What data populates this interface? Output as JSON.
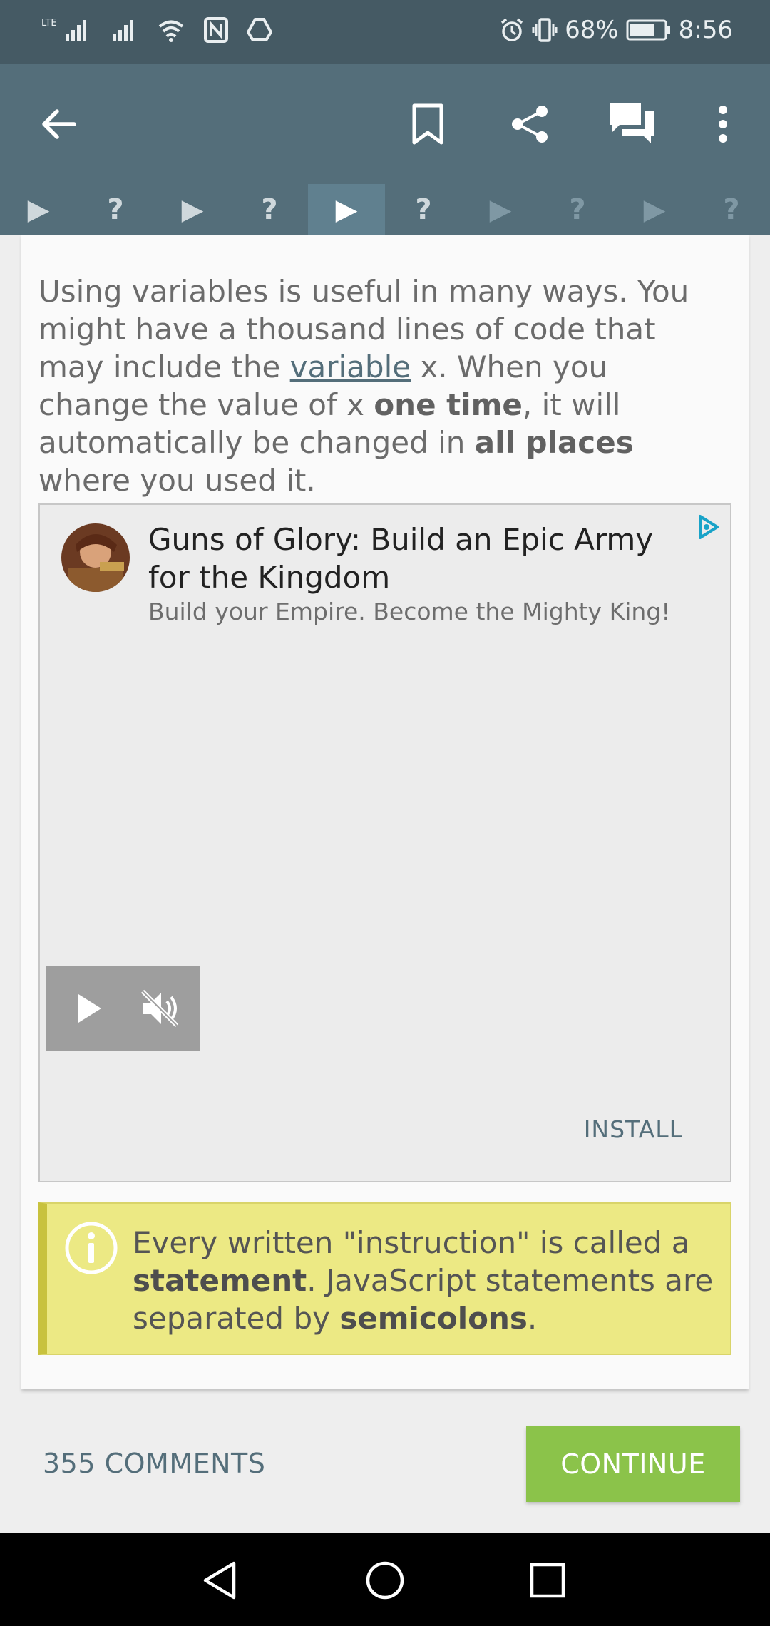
{
  "status_bar": {
    "network_label": "LTE",
    "battery_percent": "68%",
    "time": "8:56"
  },
  "app_bar": {
    "back_icon": "arrow-left-icon",
    "actions": [
      "bookmark-icon",
      "share-icon",
      "comments-icon",
      "more-vert-icon"
    ]
  },
  "lesson_steps": [
    {
      "type": "play",
      "glyph": "▶"
    },
    {
      "type": "quiz",
      "glyph": "?"
    },
    {
      "type": "play",
      "glyph": "▶"
    },
    {
      "type": "quiz",
      "glyph": "?"
    },
    {
      "type": "play",
      "glyph": "▶",
      "active": true
    },
    {
      "type": "quiz",
      "glyph": "?"
    },
    {
      "type": "play",
      "glyph": "▶",
      "locked": true
    },
    {
      "type": "quiz",
      "glyph": "?",
      "locked": true
    },
    {
      "type": "play",
      "glyph": "▶",
      "locked": true
    },
    {
      "type": "quiz",
      "glyph": "?",
      "locked": true
    }
  ],
  "content": {
    "p1": "Using variables is useful in many ways. You might have a thousand lines of code that may include the ",
    "p1_link": "variable",
    "p1_b": " x. When you change the value of x ",
    "p1_bold1": "one time",
    "p1_c": ", it will automatically be changed in ",
    "p1_bold2": "all places",
    "p1_d": " where you used it."
  },
  "ad": {
    "title": "Guns of Glory: Build an Epic Army for the Kingdom",
    "subtitle": "Build your Empire. Become the Mighty King!",
    "install_label": "INSTALL"
  },
  "note": {
    "a": "Every written \"instruction\" is called a ",
    "bold1": "statement",
    "b": ". JavaScript statements are separated by ",
    "bold2": "semicolons",
    "c": "."
  },
  "footer": {
    "comments_label": "355 COMMENTS",
    "continue_label": "CONTINUE"
  },
  "colors": {
    "status_bar": "#455a64",
    "app_bar": "#546e7a",
    "continue": "#8bc34a",
    "note_bg": "#ece984"
  }
}
